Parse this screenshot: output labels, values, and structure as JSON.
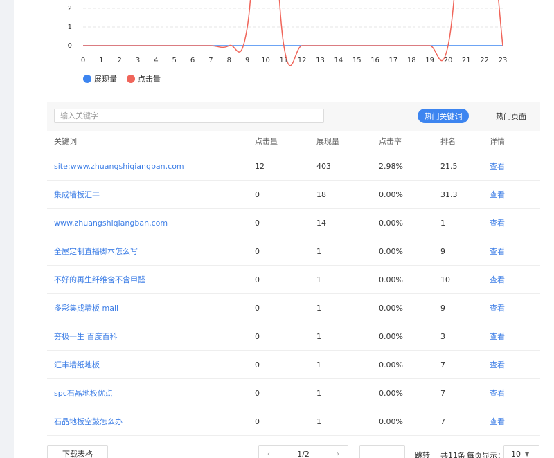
{
  "chart_data": {
    "type": "line",
    "x": [
      0,
      1,
      2,
      3,
      4,
      5,
      6,
      7,
      8,
      9,
      10,
      11,
      12,
      13,
      14,
      15,
      16,
      17,
      18,
      19,
      20,
      21,
      22,
      23
    ],
    "xlim": [
      0,
      23
    ],
    "ylim": [
      0,
      2
    ],
    "y_ticks": [
      "0",
      "1",
      "2"
    ],
    "grid": true,
    "legend_position": "bottom-left",
    "series": [
      {
        "name": "展现量",
        "color": "#3d85f0",
        "values": [
          0,
          0,
          0,
          0,
          0,
          0,
          0,
          0,
          0,
          0,
          0,
          0,
          0,
          0,
          0,
          0,
          0,
          0,
          0,
          0,
          0,
          0,
          0,
          0
        ]
      },
      {
        "name": "点击量",
        "color": "#f0655a",
        "values": [
          0,
          0,
          0,
          0,
          0,
          0,
          0,
          0,
          0,
          1,
          12,
          0,
          0,
          0,
          0,
          0,
          0,
          0,
          0,
          0,
          0,
          9,
          9,
          0
        ]
      }
    ]
  },
  "toolbar": {
    "search_placeholder": "输入关键字",
    "tab_active": "热门关键词",
    "tab_other": "热门页面"
  },
  "table": {
    "headers": [
      "关键词",
      "点击量",
      "展现量",
      "点击率",
      "排名",
      "详情"
    ],
    "rows": [
      {
        "keyword": "site:www.zhuangshiqiangban.com",
        "clicks": "12",
        "impressions": "403",
        "ctr": "2.98%",
        "rank": "21.5",
        "detail": "查看"
      },
      {
        "keyword": "集成墙板汇丰",
        "clicks": "0",
        "impressions": "18",
        "ctr": "0.00%",
        "rank": "31.3",
        "detail": "查看"
      },
      {
        "keyword": "www.zhuangshiqiangban.com",
        "clicks": "0",
        "impressions": "14",
        "ctr": "0.00%",
        "rank": "1",
        "detail": "查看"
      },
      {
        "keyword": "全屋定制直播脚本怎么写",
        "clicks": "0",
        "impressions": "1",
        "ctr": "0.00%",
        "rank": "9",
        "detail": "查看"
      },
      {
        "keyword": "不好的再生纤维含不含甲醛",
        "clicks": "0",
        "impressions": "1",
        "ctr": "0.00%",
        "rank": "10",
        "detail": "查看"
      },
      {
        "keyword": "多彩集成墙板 mail",
        "clicks": "0",
        "impressions": "1",
        "ctr": "0.00%",
        "rank": "9",
        "detail": "查看"
      },
      {
        "keyword": "夯极一生 百度百科",
        "clicks": "0",
        "impressions": "1",
        "ctr": "0.00%",
        "rank": "3",
        "detail": "查看"
      },
      {
        "keyword": "汇丰墙纸地板",
        "clicks": "0",
        "impressions": "1",
        "ctr": "0.00%",
        "rank": "7",
        "detail": "查看"
      },
      {
        "keyword": "spc石晶地板优点",
        "clicks": "0",
        "impressions": "1",
        "ctr": "0.00%",
        "rank": "7",
        "detail": "查看"
      },
      {
        "keyword": "石晶地板空鼓怎么办",
        "clicks": "0",
        "impressions": "1",
        "ctr": "0.00%",
        "rank": "7",
        "detail": "查看"
      }
    ]
  },
  "footer": {
    "download": "下载表格",
    "page_indicator": "1/2",
    "prev_arrow": "‹",
    "next_arrow": "›",
    "jump": "跳转",
    "total": "共11条",
    "per_page_label": "每页显示：",
    "per_page_value": "10"
  }
}
